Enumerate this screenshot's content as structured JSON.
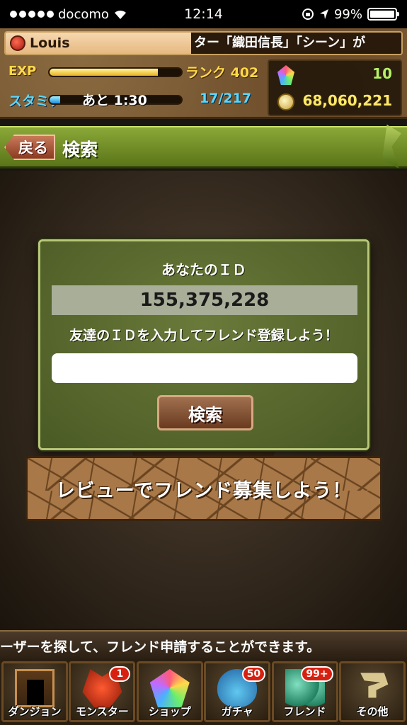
{
  "status_bar": {
    "carrier": "docomo",
    "time": "12:14",
    "battery": "99%",
    "battery_level": 0.99,
    "icons": [
      "signal-dots-icon",
      "wifi-icon",
      "orientation-lock-icon",
      "location-icon",
      "battery-icon"
    ]
  },
  "header": {
    "player_name": "Louis",
    "ticker": "ター「織田信長」「シーン」が",
    "exp_label": "EXP",
    "exp_progress": 0.82,
    "rank": "ランク 402",
    "stamina_label": "スタミナ",
    "stamina_progress": 0.08,
    "stamina_timer": "あと 1:30",
    "stamina": "17/217",
    "magic_stones": "10",
    "coins": "68,060,221"
  },
  "title_bar": {
    "back_label": "戻る",
    "title": "検索"
  },
  "dialog": {
    "id_label": "あなたのＩＤ",
    "player_id": "155,375,228",
    "instruction": "友達のＩＤを入力してフレンド登録しよう！",
    "input_value": "",
    "search_label": "検索"
  },
  "review_banner": "レビューでフレンド募集しよう！",
  "info_text": "ーザーを探して、フレンド申請することができます。",
  "nav": [
    {
      "label": "ダンジョン",
      "badge": ""
    },
    {
      "label": "モンスター",
      "badge": "1"
    },
    {
      "label": "ショップ",
      "badge": ""
    },
    {
      "label": "ガチャ",
      "badge": "50"
    },
    {
      "label": "フレンド",
      "badge": "99+"
    },
    {
      "label": "その他",
      "badge": ""
    }
  ],
  "colors": {
    "accent_green": "#8aa838",
    "stamina_blue": "#5ad8ff",
    "exp_gold": "#ffd84a",
    "badge_red": "#d82010"
  }
}
